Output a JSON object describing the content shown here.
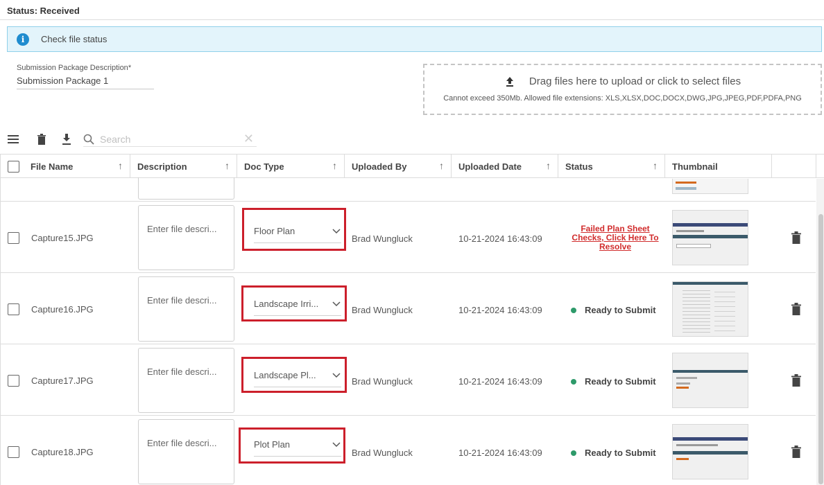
{
  "status_line": "Status: Received",
  "info_banner": {
    "icon": "info-icon",
    "text": "Check file status"
  },
  "package": {
    "label": "Submission Package Description",
    "required_marker": "*",
    "value": "Submission Package 1"
  },
  "dropzone": {
    "title": "Drag files here to upload or click to select files",
    "note": "Cannot exceed 350Mb. Allowed file extensions: XLS,XLSX,DOC,DOCX,DWG,JPG,JPEG,PDF,PDFA,PNG"
  },
  "toolbar": {
    "icons": [
      "menu-icon",
      "trash-icon",
      "download-icon",
      "search-icon",
      "close-icon"
    ],
    "search_placeholder": "Search"
  },
  "table": {
    "columns": [
      "File Name",
      "Description",
      "Doc Type",
      "Uploaded By",
      "Uploaded Date",
      "Status",
      "Thumbnail"
    ],
    "rows": [
      {
        "file_name": "Capture15.JPG",
        "description_placeholder": "Enter file descri...",
        "doc_type": "Floor Plan",
        "uploaded_by": "Brad Wungluck",
        "uploaded_date": "10-21-2024 16:43:09",
        "status": "Failed Plan Sheet Checks, Click Here To Resolve",
        "status_kind": "error"
      },
      {
        "file_name": "Capture16.JPG",
        "description_placeholder": "Enter file descri...",
        "doc_type": "Landscape Irri...",
        "uploaded_by": "Brad Wungluck",
        "uploaded_date": "10-21-2024 16:43:09",
        "status": "Ready to Submit",
        "status_kind": "ok"
      },
      {
        "file_name": "Capture17.JPG",
        "description_placeholder": "Enter file descri...",
        "doc_type": "Landscape Pl...",
        "uploaded_by": "Brad Wungluck",
        "uploaded_date": "10-21-2024 16:43:09",
        "status": "Ready to Submit",
        "status_kind": "ok"
      },
      {
        "file_name": "Capture18.JPG",
        "description_placeholder": "Enter file descri...",
        "doc_type": "Plot Plan",
        "uploaded_by": "Brad Wungluck",
        "uploaded_date": "10-21-2024 16:43:09",
        "status": "Ready to Submit",
        "status_kind": "ok"
      }
    ]
  },
  "colors": {
    "highlight_outline": "#cc1f2b",
    "error_text": "#d12c2c",
    "ready_dot": "#2e9a6a",
    "info_bg": "#e3f4fb",
    "info_border": "#8fd0ea",
    "info_icon": "#1f8ccf"
  }
}
